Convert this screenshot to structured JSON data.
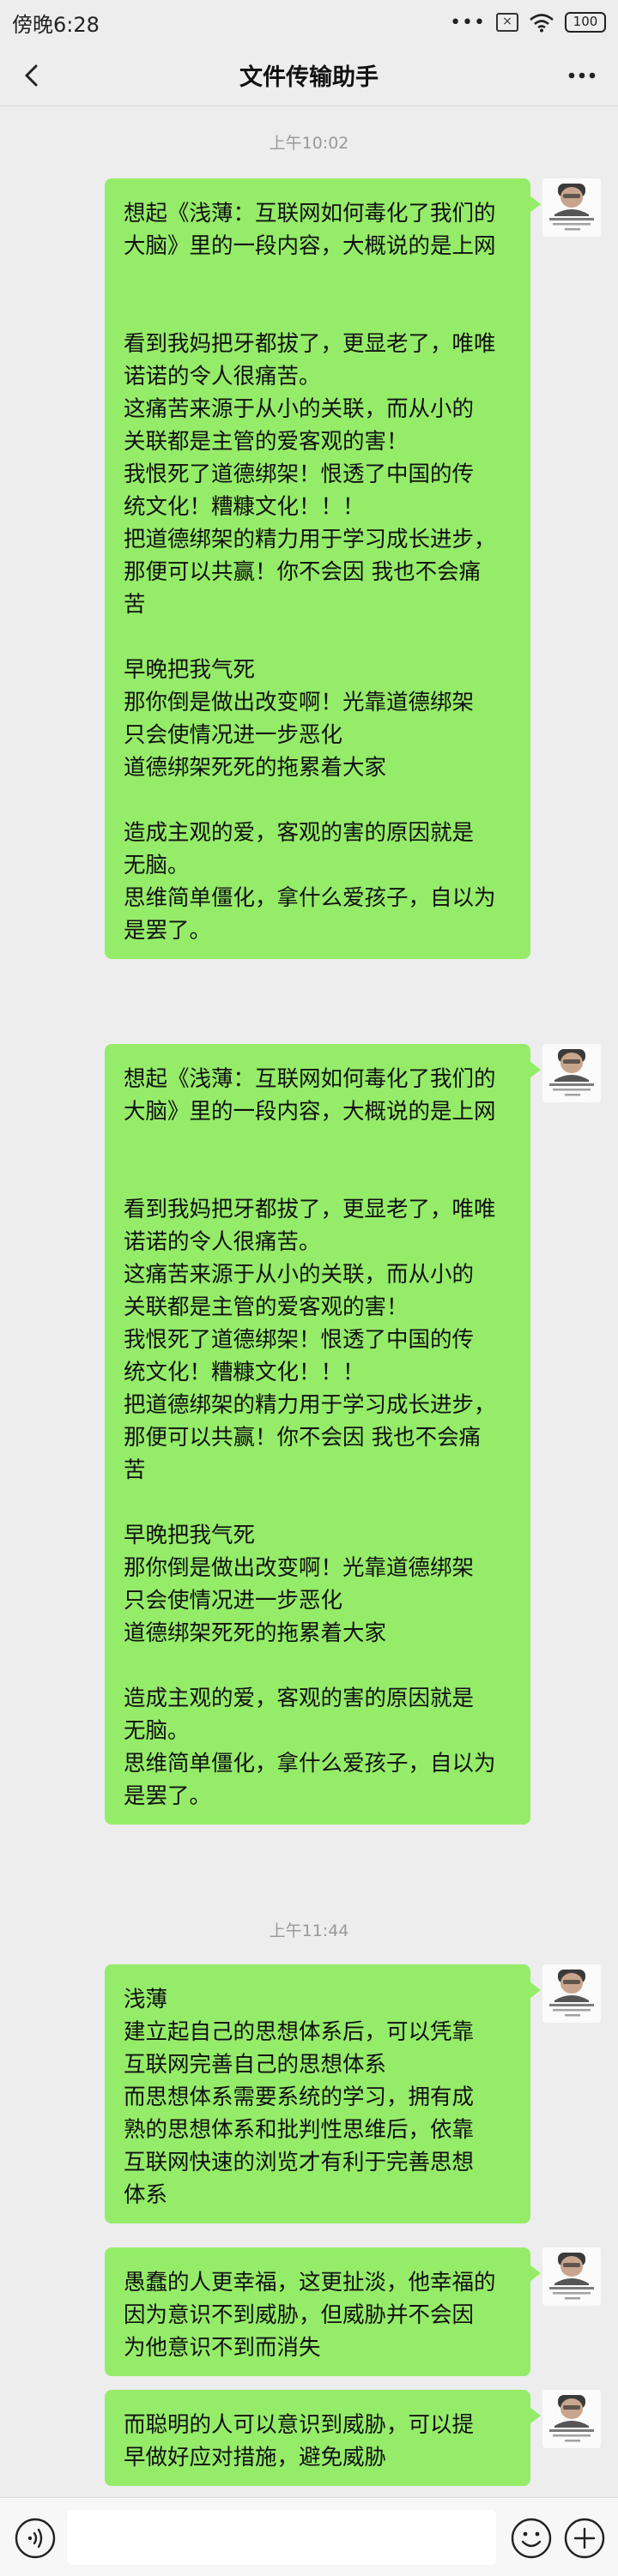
{
  "status_bar": {
    "time": "傍晚6:28",
    "dots": "•••",
    "sim_label": "×",
    "battery": "100"
  },
  "header": {
    "title": "文件传输助手"
  },
  "timestamps": [
    "上午10:02",
    "上午11:44"
  ],
  "messages": [
    {
      "lines": [
        "想起《浅薄：互联网如何毒化了我们的",
        "大脑》里的一段内容，大概说的是上网",
        "",
        "",
        "看到我妈把牙都拔了，更显老了，唯唯",
        "诺诺的令人很痛苦。",
        "这痛苦来源于从小的关联，而从小的",
        "关联都是主管的爱客观的害！",
        "我恨死了道德绑架！恨透了中国的传",
        "统文化！糟糠文化！！！",
        "把道德绑架的精力用于学习成长进步，",
        "那便可以共赢！你不会因 我也不会痛",
        "苦",
        "",
        "早晚把我气死",
        "那你倒是做出改变啊！光靠道德绑架",
        "只会使情况进一步恶化",
        "道德绑架死死的拖累着大家",
        "",
        "造成主观的爱，客观的害的原因就是",
        "无脑。",
        "思维简单僵化，拿什么爱孩子，自以为",
        "是罢了。"
      ]
    },
    {
      "lines": [
        "想起《浅薄：互联网如何毒化了我们的",
        "大脑》里的一段内容，大概说的是上网",
        "",
        "",
        "看到我妈把牙都拔了，更显老了，唯唯",
        "诺诺的令人很痛苦。",
        "这痛苦来源于从小的关联，而从小的",
        "关联都是主管的爱客观的害！",
        "我恨死了道德绑架！恨透了中国的传",
        "统文化！糟糠文化！！！",
        "把道德绑架的精力用于学习成长进步，",
        "那便可以共赢！你不会因 我也不会痛",
        "苦",
        "",
        "早晚把我气死",
        "那你倒是做出改变啊！光靠道德绑架",
        "只会使情况进一步恶化",
        "道德绑架死死的拖累着大家",
        "",
        "造成主观的爱，客观的害的原因就是",
        "无脑。",
        "思维简单僵化，拿什么爱孩子，自以为",
        "是罢了。"
      ]
    },
    {
      "lines": [
        "浅薄",
        "建立起自己的思想体系后，可以凭靠",
        "互联网完善自己的思想体系",
        "而思想体系需要系统的学习，拥有成",
        "熟的思想体系和批判性思维后，依靠",
        "互联网快速的浏览才有利于完善思想",
        "体系"
      ]
    },
    {
      "lines": [
        "愚蠢的人更幸福，这更扯淡，他幸福的",
        "因为意识不到威胁，但威胁并不会因",
        "为他意识不到而消失"
      ]
    },
    {
      "lines": [
        "而聪明的人可以意识到威胁，可以提",
        "早做好应对措施，避免威胁"
      ]
    }
  ],
  "colors": {
    "bubble": "#95ec69",
    "background": "#ededed",
    "timestamp": "#999999"
  },
  "icons": {
    "back": "chevron-left-icon",
    "more": "more-dots-icon",
    "voice": "voice-icon",
    "emoji": "emoji-icon",
    "plus": "plus-icon",
    "wifi": "wifi-icon",
    "avatar": "avatar"
  }
}
